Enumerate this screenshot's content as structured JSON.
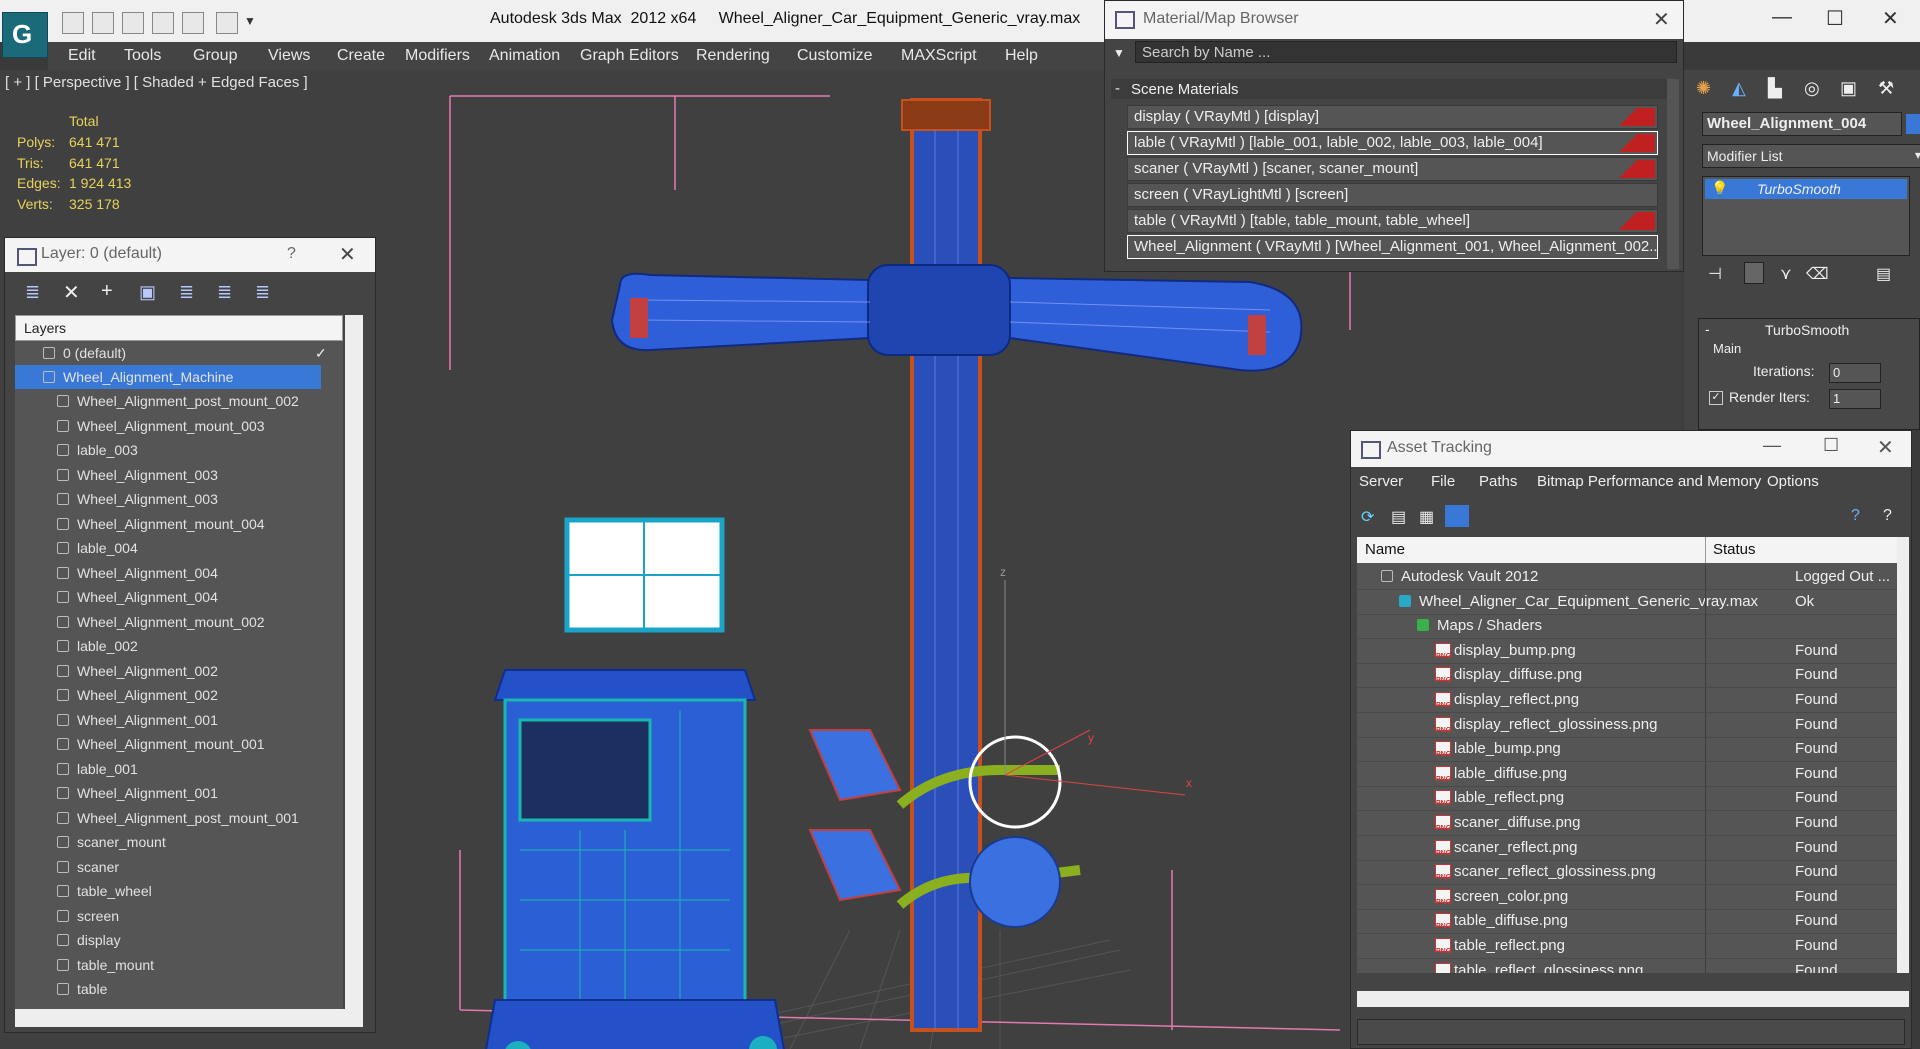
{
  "app": {
    "title": "Autodesk 3ds Max  2012 x64",
    "file": "Wheel_Aligner_Car_Equipment_Generic_vray.max",
    "logo": "3ds-max-logo"
  },
  "menu": [
    "Edit",
    "Tools",
    "Group",
    "Views",
    "Create",
    "Modifiers",
    "Animation",
    "Graph Editors",
    "Rendering",
    "Customize",
    "MAXScript",
    "Help"
  ],
  "viewport": {
    "label": "[ + ] [ Perspective ] [ Shaded + Edged Faces ]",
    "stats": {
      "total_label": "Total",
      "rows": [
        {
          "label": "Polys:",
          "value": "641 471"
        },
        {
          "label": "Tris:",
          "value": "641 471"
        },
        {
          "label": "Edges:",
          "value": "1 924 413"
        },
        {
          "label": "Verts:",
          "value": "325 178"
        }
      ]
    },
    "axis": {
      "x": "x",
      "y": "y",
      "z": "z"
    }
  },
  "layer_panel": {
    "title": "Layer: 0 (default)",
    "help": "?",
    "header": "Layers",
    "default_layer": "0 (default)",
    "selected_layer": "Wheel_Alignment_Machine",
    "objects": [
      "Wheel_Alignment_post_mount_002",
      "Wheel_Alignment_mount_003",
      "lable_003",
      "Wheel_Alignment_003",
      "Wheel_Alignment_003",
      "Wheel_Alignment_mount_004",
      "lable_004",
      "Wheel_Alignment_004",
      "Wheel_Alignment_004",
      "Wheel_Alignment_mount_002",
      "lable_002",
      "Wheel_Alignment_002",
      "Wheel_Alignment_002",
      "Wheel_Alignment_001",
      "Wheel_Alignment_mount_001",
      "lable_001",
      "Wheel_Alignment_001",
      "Wheel_Alignment_post_mount_001",
      "scaner_mount",
      "scaner",
      "table_wheel",
      "screen",
      "display",
      "table_mount",
      "table"
    ]
  },
  "material_browser": {
    "title": "Material/Map Browser",
    "search_placeholder": "Search by Name ...",
    "group": "Scene Materials",
    "materials": [
      {
        "name": "display  ( VRayMtl )  [display]",
        "swatch": true
      },
      {
        "name": "lable  ( VRayMtl )  [lable_001, lable_002, lable_003, lable_004]",
        "swatch": true
      },
      {
        "name": "scaner  ( VRayMtl )  [scaner, scaner_mount]",
        "swatch": true
      },
      {
        "name": "screen  ( VRayLightMtl )  [screen]",
        "swatch": false
      },
      {
        "name": "table  ( VRayMtl )  [table, table_mount, table_wheel]",
        "swatch": true
      },
      {
        "name": "Wheel_Alignment  ( VRayMtl )  [Wheel_Alignment_001, Wheel_Alignment_002...",
        "swatch": false
      }
    ]
  },
  "command_panel": {
    "object_name": "Wheel_Alignment_004",
    "modifier_list": "Modifier List",
    "modifier": "TurboSmooth",
    "rollout": "TurboSmooth",
    "group": "Main",
    "iterations_label": "Iterations:",
    "iterations_value": "0",
    "render_iters_label": "Render Iters:",
    "render_iters_value": "1"
  },
  "asset_tracking": {
    "title": "Asset Tracking",
    "menu": [
      "Server",
      "File",
      "Paths",
      "Bitmap Performance and Memory",
      "Options"
    ],
    "columns": [
      "Name",
      "Status"
    ],
    "rows": [
      {
        "name": "Autodesk Vault 2012",
        "status": "Logged Out ...",
        "indent": 1,
        "icon": "vault-icon"
      },
      {
        "name": "Wheel_Aligner_Car_Equipment_Generic_vray.max",
        "status": "Ok",
        "indent": 2,
        "icon": "max-file-icon"
      },
      {
        "name": "Maps / Shaders",
        "status": "",
        "indent": 3,
        "icon": "folder-icon"
      },
      {
        "name": "display_bump.png",
        "status": "Found",
        "indent": 4,
        "icon": "png-icon"
      },
      {
        "name": "display_diffuse.png",
        "status": "Found",
        "indent": 4,
        "icon": "png-icon"
      },
      {
        "name": "display_reflect.png",
        "status": "Found",
        "indent": 4,
        "icon": "png-icon"
      },
      {
        "name": "display_reflect_glossiness.png",
        "status": "Found",
        "indent": 4,
        "icon": "png-icon"
      },
      {
        "name": "lable_bump.png",
        "status": "Found",
        "indent": 4,
        "icon": "png-icon"
      },
      {
        "name": "lable_diffuse.png",
        "status": "Found",
        "indent": 4,
        "icon": "png-icon"
      },
      {
        "name": "lable_reflect.png",
        "status": "Found",
        "indent": 4,
        "icon": "png-icon"
      },
      {
        "name": "scaner_diffuse.png",
        "status": "Found",
        "indent": 4,
        "icon": "png-icon"
      },
      {
        "name": "scaner_reflect.png",
        "status": "Found",
        "indent": 4,
        "icon": "png-icon"
      },
      {
        "name": "scaner_reflect_glossiness.png",
        "status": "Found",
        "indent": 4,
        "icon": "png-icon"
      },
      {
        "name": "screen_color.png",
        "status": "Found",
        "indent": 4,
        "icon": "png-icon"
      },
      {
        "name": "table_diffuse.png",
        "status": "Found",
        "indent": 4,
        "icon": "png-icon"
      },
      {
        "name": "table_reflect.png",
        "status": "Found",
        "indent": 4,
        "icon": "png-icon"
      },
      {
        "name": "table_reflect_glossiness.png",
        "status": "Found",
        "indent": 4,
        "icon": "png-icon"
      }
    ]
  },
  "colors": {
    "selection": "#3a78d8",
    "stats": "#e8d25a",
    "wire_blue": "#2c5fd0",
    "wire_orange": "#c8501c"
  }
}
